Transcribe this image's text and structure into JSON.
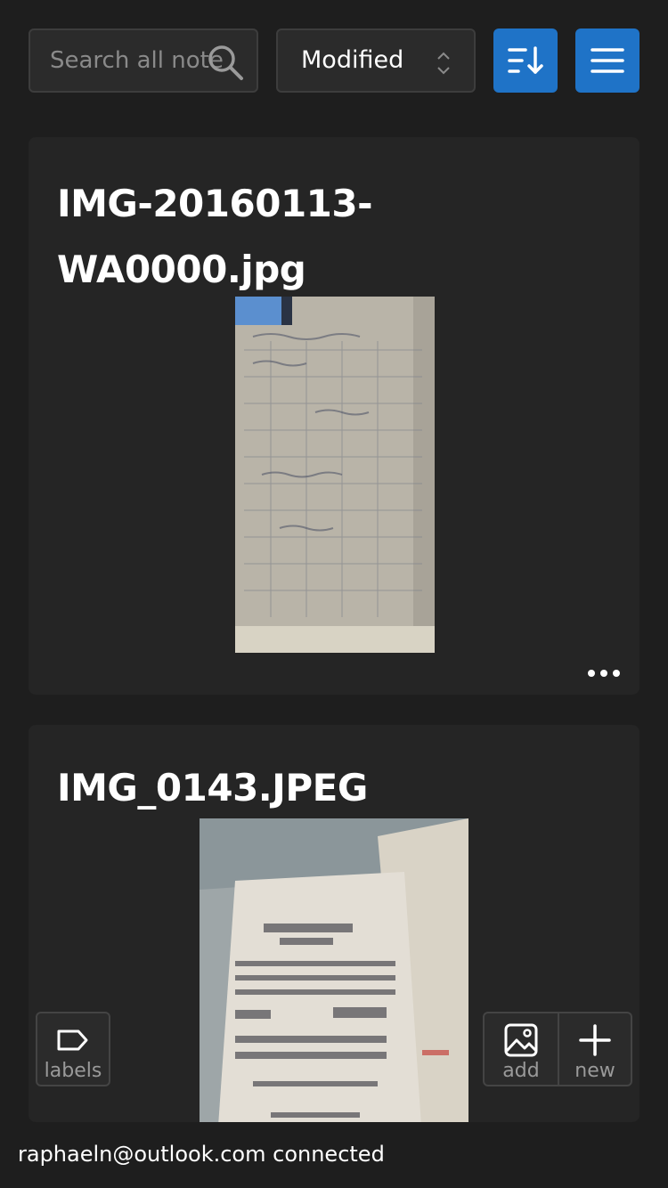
{
  "toolbar": {
    "search": {
      "placeholder": "Search all notes",
      "value": "",
      "icon": "search-icon"
    },
    "sort_select": {
      "selected": "Modified",
      "icon": "chevron-up-down-icon"
    },
    "sort_direction_button": {
      "icon": "sort-descending-icon"
    },
    "menu_button": {
      "icon": "hamburger-menu-icon"
    },
    "accent_color": "#1f73c7"
  },
  "notes": [
    {
      "title": "IMG-20160113-WA0000.jpg",
      "thumbnail": "photo-of-handwritten-grid-notes",
      "more_icon": "more-horizontal-icon"
    },
    {
      "title": "IMG_0143.JPEG",
      "thumbnail": "photo-of-paper-receipts"
    }
  ],
  "actions": {
    "labels": {
      "label": "labels",
      "icon": "tag-icon"
    },
    "add": {
      "label": "add",
      "icon": "image-icon"
    },
    "new": {
      "label": "new",
      "icon": "plus-icon"
    }
  },
  "status": {
    "text": "raphaeln@outlook.com connected"
  }
}
